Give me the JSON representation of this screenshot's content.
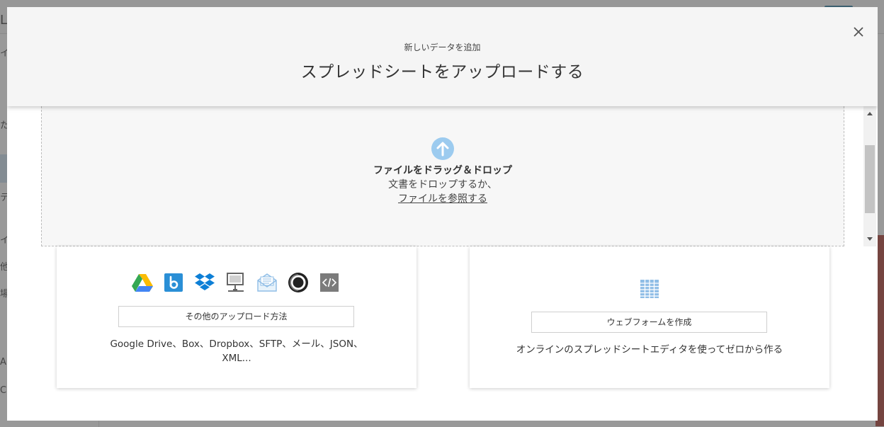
{
  "modal": {
    "subtitle": "新しいデータを追加",
    "title": "スプレッドシートをアップロードする"
  },
  "dropzone": {
    "heading": "ファイルをドラッグ＆ドロップ",
    "line2": "文書をドロップするか、",
    "browse_link": "ファイルを参照する"
  },
  "upload_card": {
    "icons": [
      "google-drive-icon",
      "box-icon",
      "dropbox-icon",
      "network-server-icon",
      "email-icon",
      "json-icon",
      "xml-code-icon"
    ],
    "button_label": "その他のアップロード方法",
    "description": "Google Drive、Box、Dropbox、SFTP、メール、JSON、XML..."
  },
  "webform_card": {
    "icon": "table-icon",
    "button_label": "ウェブフォームを作成",
    "description": "オンラインのスプレッドシートエディタを使ってゼロから作る"
  },
  "background": {
    "chars": [
      "L",
      "イ",
      "た",
      "テ",
      "イ",
      "他",
      "場",
      "Ap",
      "C"
    ]
  },
  "colors": {
    "accent_blue": "#9ccbef",
    "table_blue": "#8fbde6",
    "overlay": "#8f8f8f"
  }
}
